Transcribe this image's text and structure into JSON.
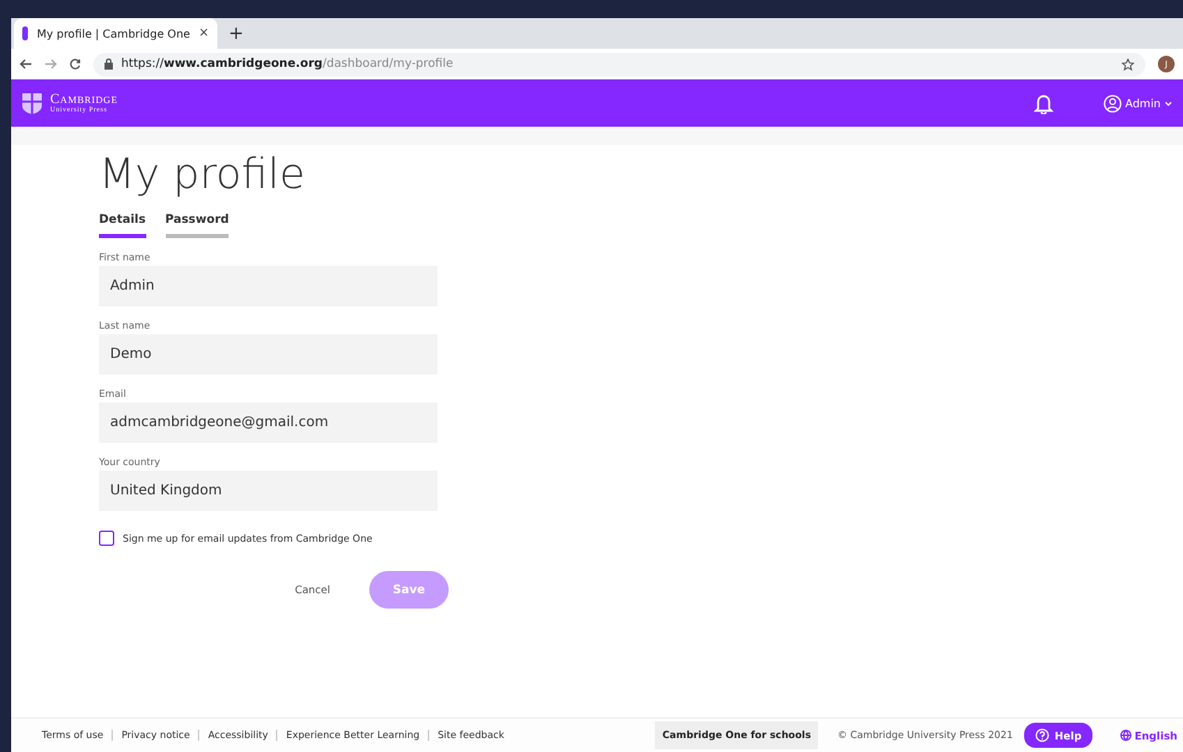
{
  "browser": {
    "tab_title": "My profile | Cambridge One",
    "tab_close": "×",
    "new_tab": "+",
    "url": {
      "scheme": "https://",
      "host": "www.cambridgeone.org",
      "path": "/dashboard/my-profile"
    },
    "profile_initial": "J"
  },
  "header": {
    "brand": "Cambridge",
    "brand_sub": "University Press",
    "user": "Admin"
  },
  "page": {
    "title": "My profile",
    "tabs": [
      {
        "label": "Details",
        "selected": true
      },
      {
        "label": "Password",
        "selected": false
      }
    ],
    "fields": [
      {
        "label": "First name",
        "value": "Admin"
      },
      {
        "label": "Last name",
        "value": "Demo"
      },
      {
        "label": "Email",
        "value": "admcambridgeone@gmail.com"
      },
      {
        "label": "Your country",
        "value": "United Kingdom"
      }
    ],
    "newsletter": {
      "label": "Sign me up for email updates from Cambridge One",
      "checked": false
    },
    "cancel": "Cancel",
    "save": {
      "label": "Save",
      "disabled": true
    }
  },
  "footer": {
    "links": [
      "Terms of use",
      "Privacy notice",
      "Accessibility",
      "Experience Better Learning",
      "Site feedback"
    ],
    "schools": "Cambridge One for schools",
    "copyright": "© Cambridge University Press 2021",
    "help": "Help",
    "language": "English"
  }
}
